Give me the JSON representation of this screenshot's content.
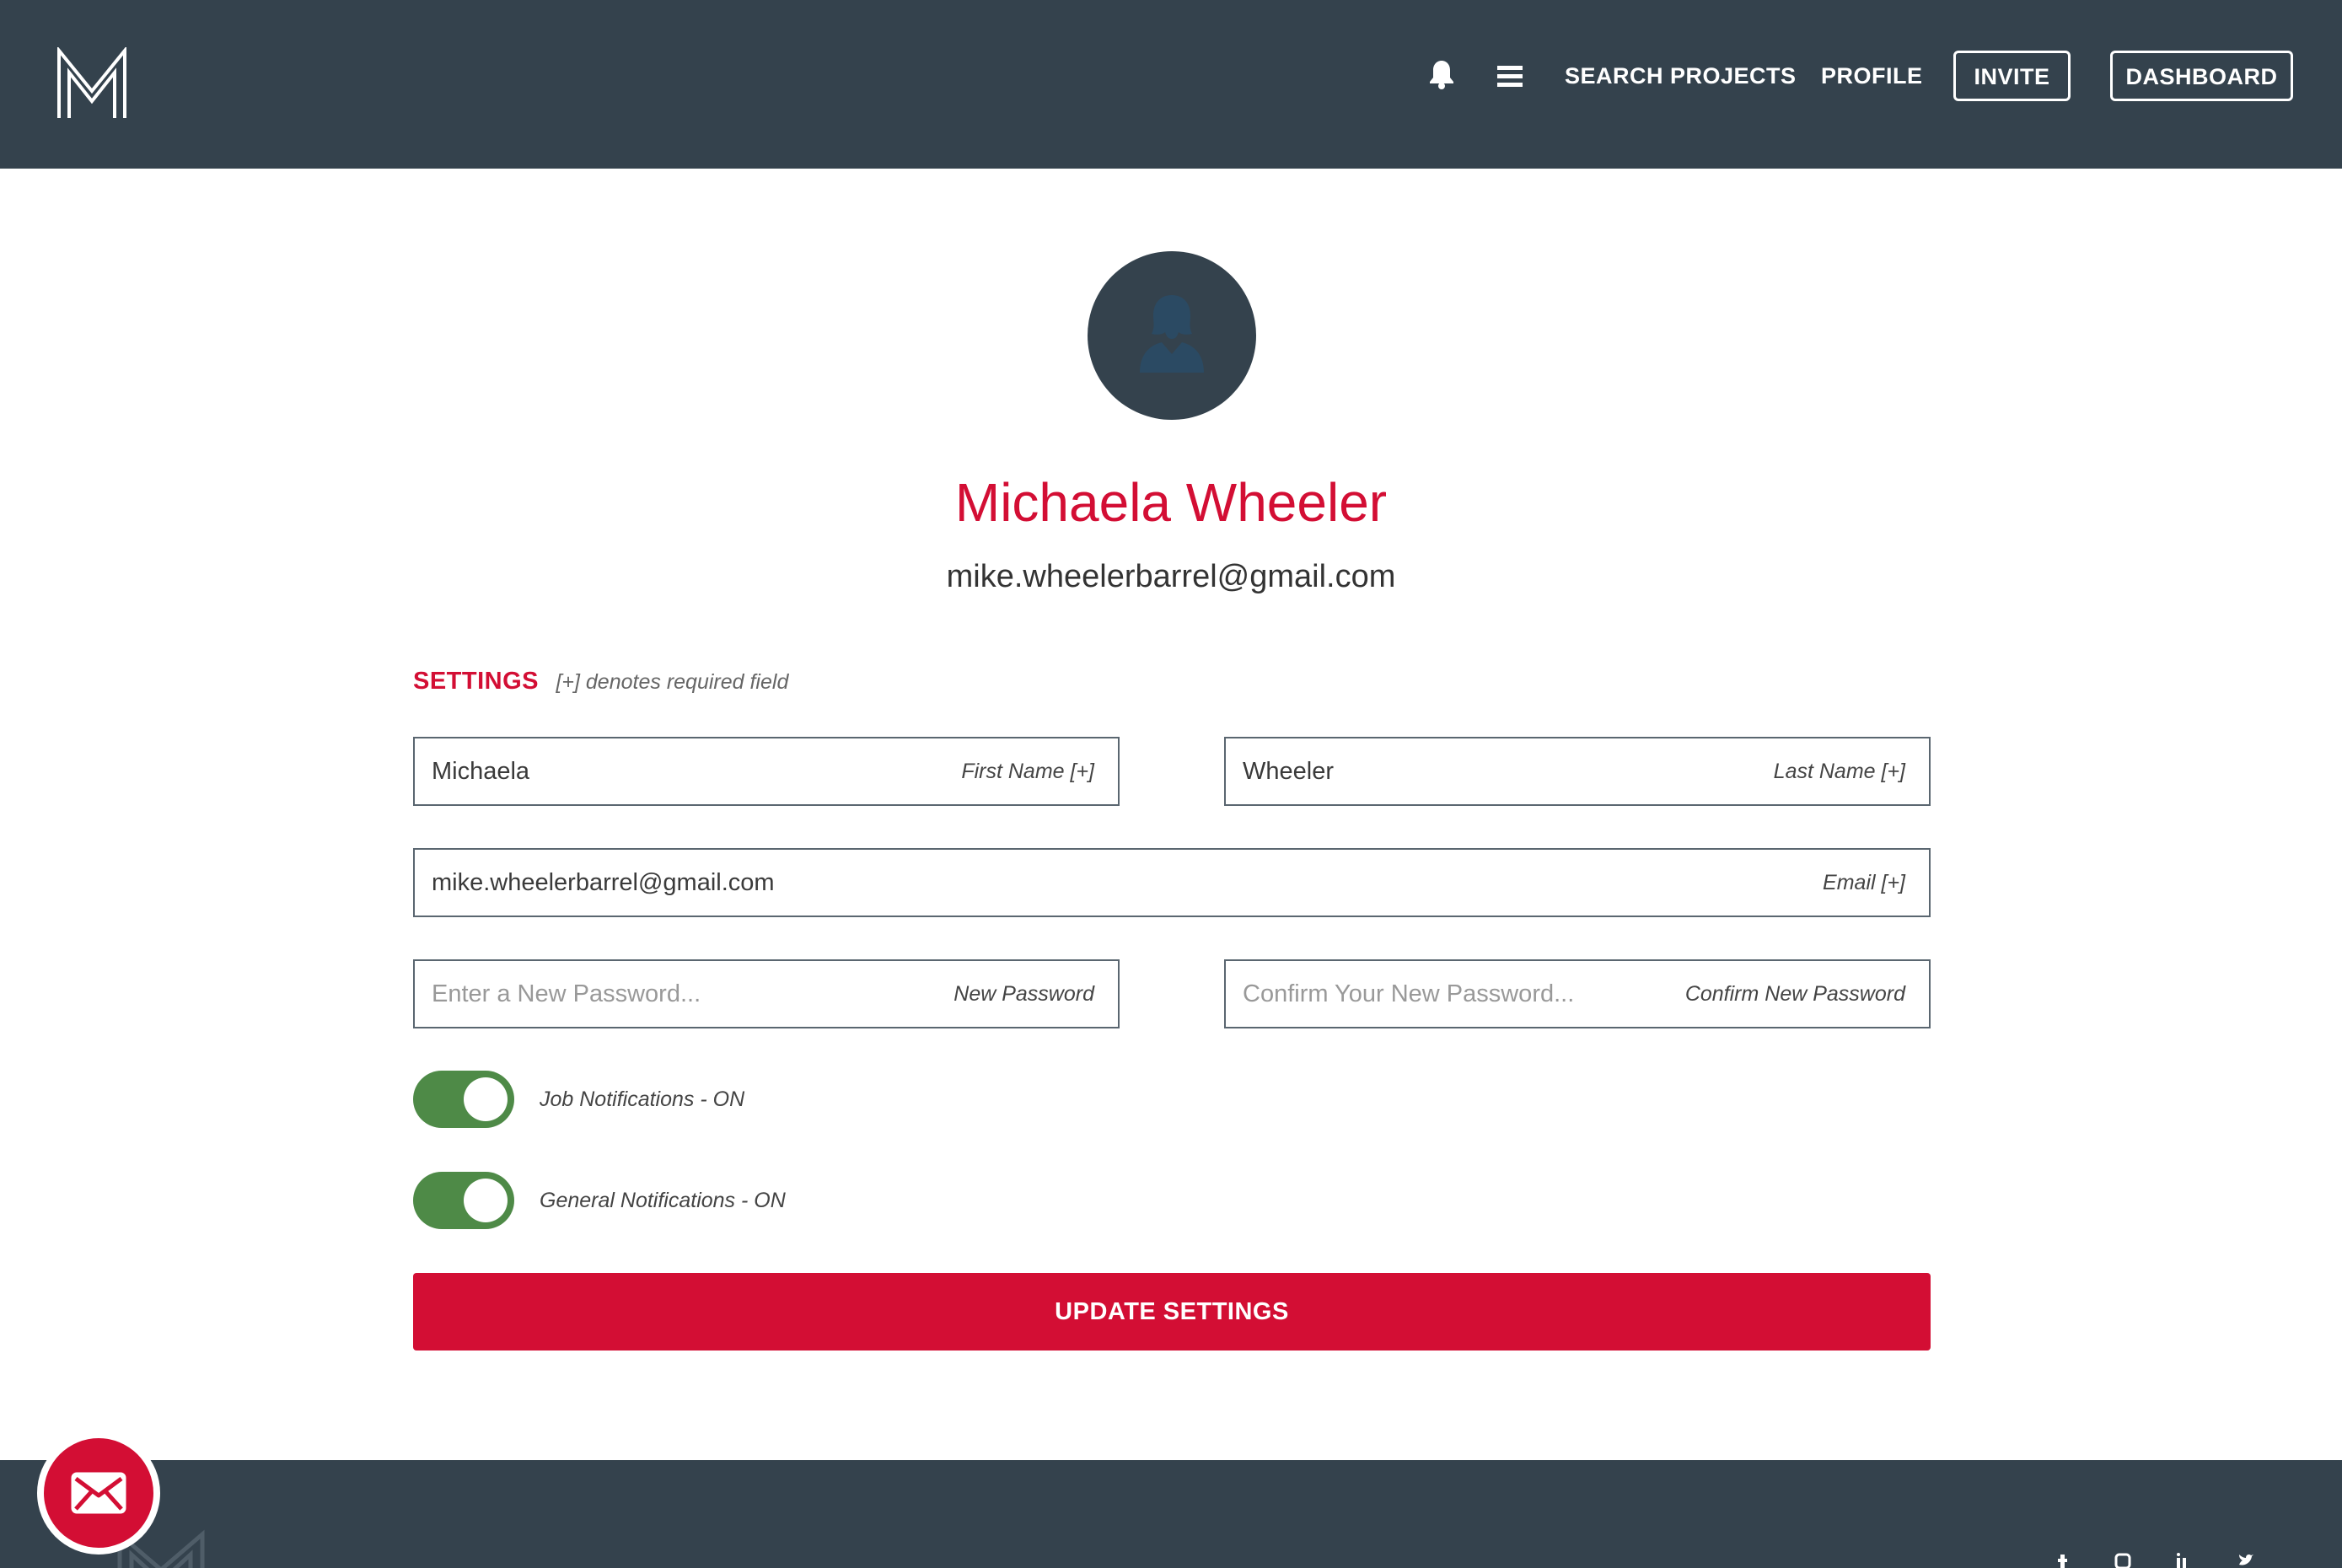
{
  "header": {
    "logo_icon": "m-logo-icon",
    "notifications_icon": "bell-icon",
    "menu_icon": "hamburger-menu-icon",
    "nav": {
      "search_projects": "SEARCH PROJECTS",
      "profile": "PROFILE",
      "invite": "INVITE",
      "dashboard": "DASHBOARD"
    }
  },
  "profile": {
    "avatar_icon": "user-avatar-icon",
    "name": "Michaela Wheeler",
    "email": "mike.wheelerbarrel@gmail.com"
  },
  "settings": {
    "title": "SETTINGS",
    "required_note": "[+] denotes required field",
    "first_name": {
      "value": "Michaela",
      "label": "First Name [+]"
    },
    "last_name": {
      "value": "Wheeler",
      "label": "Last Name [+]"
    },
    "email": {
      "value": "mike.wheelerbarrel@gmail.com",
      "label": "Email [+]"
    },
    "new_password": {
      "placeholder": "Enter a New Password...",
      "label": "New Password"
    },
    "confirm_password": {
      "placeholder": "Confirm Your New Password...",
      "label": "Confirm New Password"
    },
    "toggles": [
      {
        "label": "Job Notifications - ON",
        "state": "on"
      },
      {
        "label": "General Notifications - ON",
        "state": "on"
      }
    ],
    "update_button": "UPDATE SETTINGS"
  },
  "footer": {
    "logo_icon": "m-logo-icon",
    "social_icons": [
      "facebook-icon",
      "instagram-icon",
      "linkedin-icon",
      "twitter-icon"
    ]
  },
  "floating_action": {
    "icon": "mail-icon"
  },
  "colors": {
    "header_bg": "#34424d",
    "accent_red": "#d30e34",
    "toggle_green": "#4e8a47",
    "white": "#ffffff"
  }
}
